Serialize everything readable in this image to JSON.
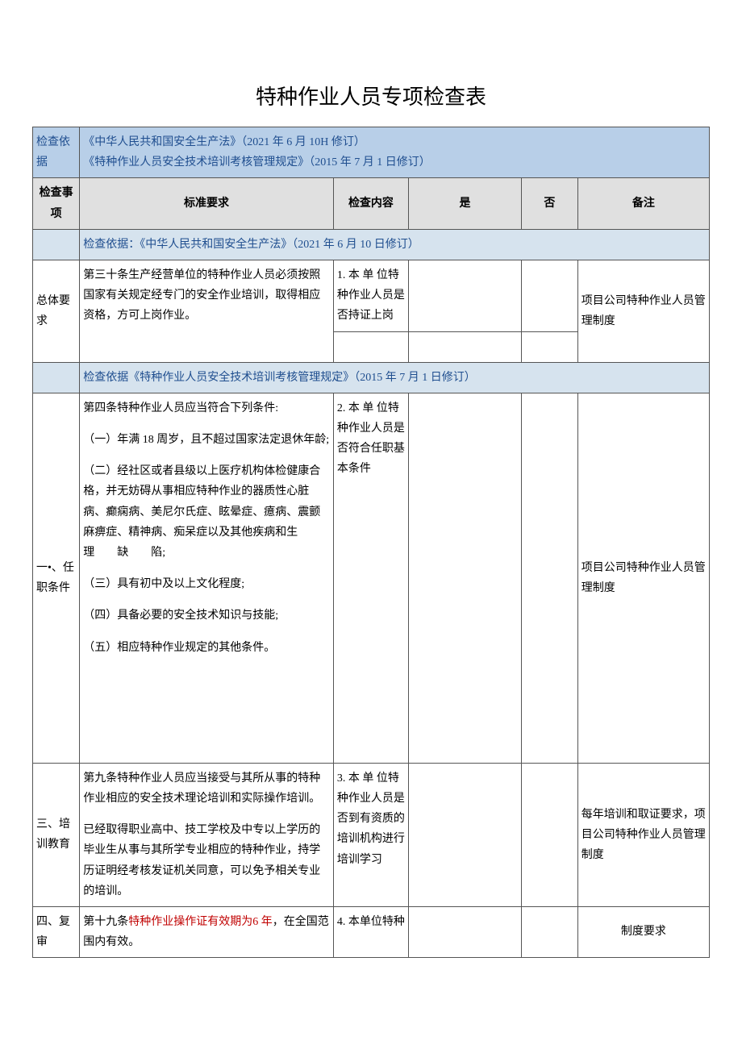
{
  "title": "特种作业人员专项检查表",
  "basis_header": "检查依据",
  "basis_text": "《中华人民共和国安全生产法》（2021 年 6 月 10H 修订）\n《特种作业人员安全技术培训考核管理规定》（2015 年 7 月 1 日修订）",
  "columns": {
    "item": "检查事项",
    "standard": "标准要求",
    "content": "检查内容",
    "yes": "是",
    "no": "否",
    "note": "备注"
  },
  "section1_header": "检查依据：《中华人民共和国安全生产法》（2021 年 6 月 10 日修订）",
  "row1": {
    "item": "总体要求",
    "standard": "第三十条生产经营单位的特种作业人员必须按照国家有关规定经专门的安全作业培训，取得相应资格，方可上岗作业。",
    "content": "1. 本 单 位特种作业人员是否持证上岗",
    "note": "项目公司特种作业人员管理制度"
  },
  "section2_header": "检查依据《特种作业人员安全技术培训考核管理规定》（2015 年 7 月 1 日修订）",
  "row2": {
    "item": "一•、任职条件",
    "standard_p1": "第四条特种作业人员应当符合下列条件:",
    "standard_p2": "（一）年满 18 周岁，且不超过国家法定退休年龄;",
    "standard_p3": "（二）经社区或者县级以上医疗机构体检健康合格，并无妨碍从事相应特种作业的器质性心脏病、癫痫病、美尼尔氏症、眩晕症、癔病、震颤麻痹症、精神病、痴呆症以及其他疾病和生　　理　　缺　　陷;",
    "standard_p4": "（三）具有初中及以上文化程度;",
    "standard_p5": "（四）具备必要的安全技术知识与技能;",
    "standard_p6": "（五）相应特种作业规定的其他条件。",
    "content": "2. 本 单 位特种作业人员是否符合任职基本条件",
    "note": "项目公司特种作业人员管理制度"
  },
  "row3": {
    "item": "三、培训教育",
    "standard_p1": "第九条特种作业人员应当接受与其所从事的特种作业相应的安全技术理论培训和实际操作培训。",
    "standard_p2": "已经取得职业高中、技工学校及中专以上学历的毕业生从事与其所学专业相应的特种作业，持学历证明经考核发证机关同意，可以免予相关专业的培训。",
    "content": "3. 本 单 位特种作业人员是否到有资质的培训机构进行培训学习",
    "note": "每年培训和取证要求，项目公司特种作业人员管理制度"
  },
  "row4": {
    "item": "四、复审",
    "standard_pre": "第十九条",
    "standard_hl": "特种作业操作证有效期为6 年",
    "standard_post": "，在全国范围内有效。",
    "content": "4. 本单位特种",
    "note": "制度要求"
  }
}
